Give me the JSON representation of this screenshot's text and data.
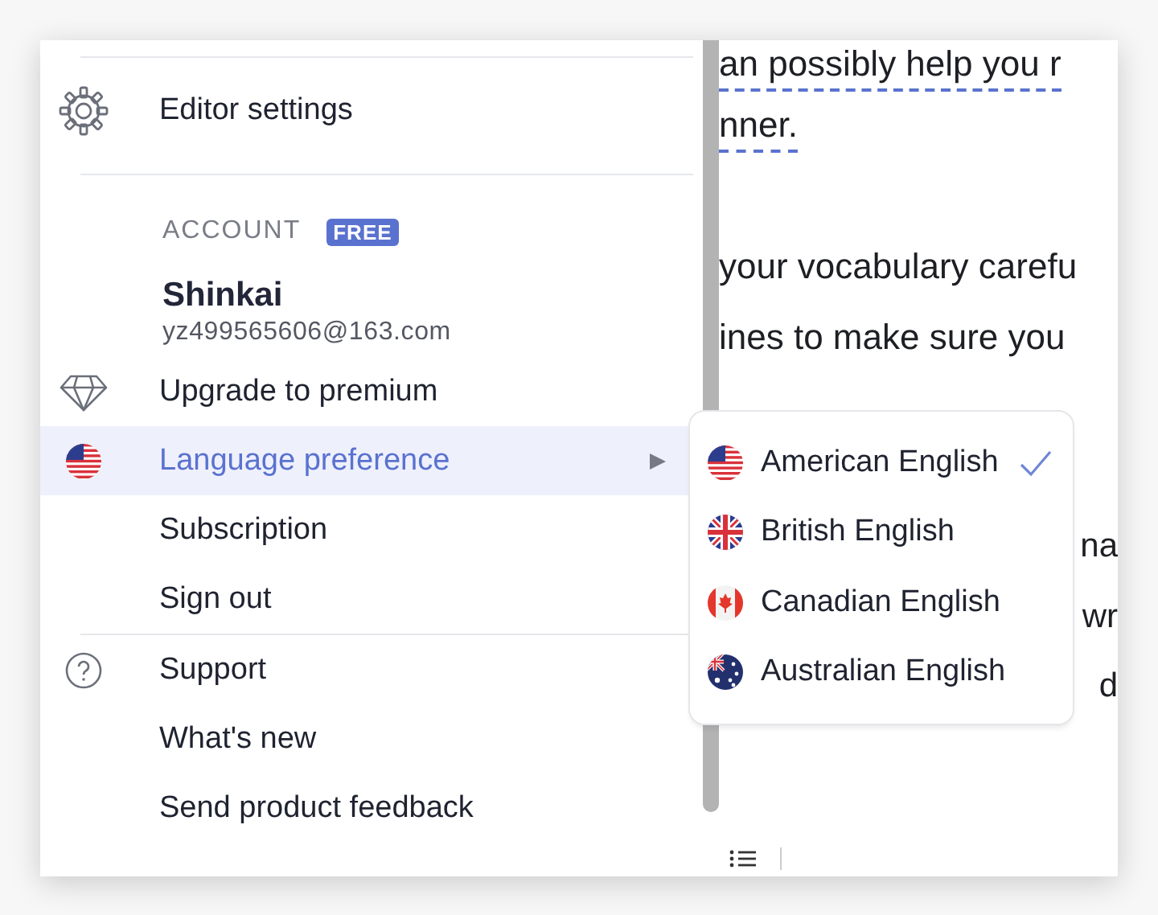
{
  "menu": {
    "items": [
      {
        "kind": "divider"
      },
      {
        "kind": "settings",
        "label": "Editor settings"
      },
      {
        "kind": "divider"
      },
      {
        "kind": "account",
        "heading": "ACCOUNT",
        "badge": "FREE",
        "name": "Shinkai",
        "email": "yz499565606@163.com"
      },
      {
        "kind": "upgrade",
        "label": "Upgrade to premium"
      },
      {
        "kind": "language",
        "label": "Language preference",
        "selected": true,
        "submenu": true
      },
      {
        "kind": "link",
        "label": "Subscription"
      },
      {
        "kind": "link",
        "label": "Sign out"
      },
      {
        "kind": "divider"
      },
      {
        "kind": "support",
        "label": "Support"
      },
      {
        "kind": "link",
        "label": "What's new"
      },
      {
        "kind": "link",
        "label": "Send product feedback"
      }
    ]
  },
  "language_submenu": {
    "options": [
      {
        "kind": "us",
        "label": "American English",
        "selected": true
      },
      {
        "kind": "gb",
        "label": "British English",
        "selected": false
      },
      {
        "kind": "ca",
        "label": "Canadian English",
        "selected": false
      },
      {
        "kind": "au",
        "label": "Australian English",
        "selected": false
      }
    ]
  },
  "document": {
    "lines": [
      {
        "kind": "line",
        "text": "an possibly help you r",
        "flagged": true
      },
      {
        "kind": "line",
        "text": "nner.",
        "flagged": true
      },
      {
        "kind": "para",
        "text": "your vocabulary carefu"
      },
      {
        "kind": "line",
        "text": "ines to make sure you"
      },
      {
        "kind": "section",
        "text": "na",
        "tail": true
      },
      {
        "kind": "line",
        "text": "wr",
        "tail": true
      },
      {
        "kind": "line",
        "text": "d",
        "tail": true
      }
    ]
  }
}
